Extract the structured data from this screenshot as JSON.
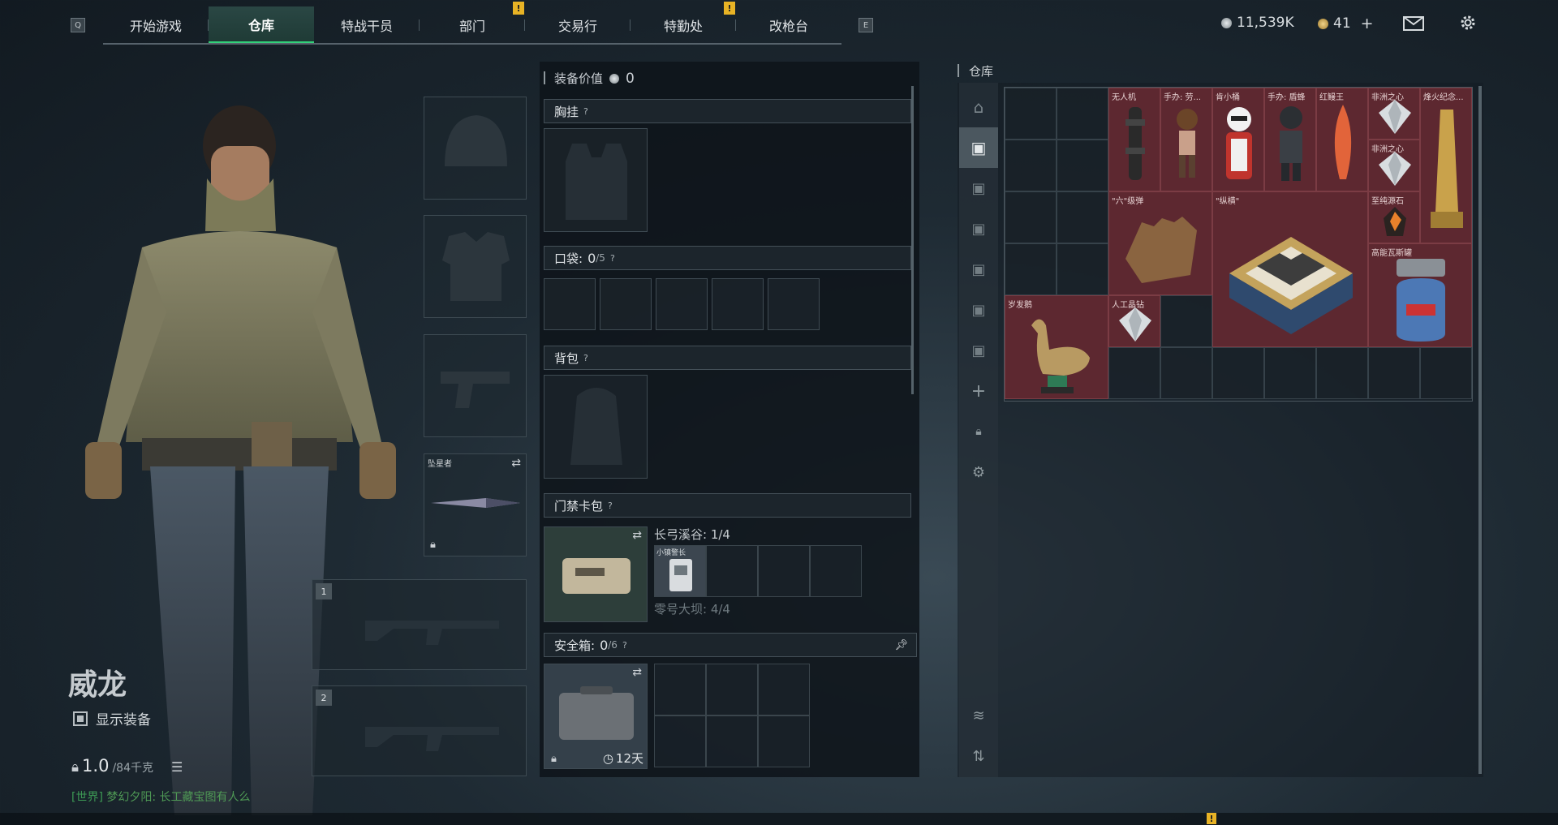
{
  "nav": {
    "key_left": "Q",
    "key_right": "E",
    "tabs": [
      {
        "label": "开始游戏",
        "active": false
      },
      {
        "label": "仓库",
        "active": true
      },
      {
        "label": "特战干员",
        "active": false
      },
      {
        "label": "部门",
        "active": false
      },
      {
        "label": "交易行",
        "active": false
      },
      {
        "label": "特勤处",
        "active": false
      },
      {
        "label": "改枪台",
        "active": false
      }
    ],
    "warning_glyph": "!"
  },
  "topbar": {
    "silver_amount": "11,539K",
    "gold_amount": "41",
    "add_glyph": "+",
    "mail_icon": "mail-icon",
    "settings_icon": "gear-icon"
  },
  "character": {
    "name": "威龙",
    "show_gear_label": "显示装备",
    "weight_value": "1.0",
    "weight_capacity": "/84千克",
    "chat_channel": "[世界]",
    "chat_message": "梦幻夕阳: 长工藏宝图有人么"
  },
  "equipment_slots": {
    "melee_label": "坠星者",
    "weapon_slot_1": "1",
    "weapon_slot_2": "2"
  },
  "loadout": {
    "value_label": "装备价值",
    "value_amount": "0",
    "chest_rig": "胸挂",
    "pockets_label": "口袋:",
    "pockets_count": "0",
    "pockets_capacity": "/5",
    "backpack": "背包",
    "keycard_case": "门禁卡包",
    "keycard_map_1": "长弓溪谷: 1/4",
    "keycard_item": "小镇警长",
    "keycard_map_2": "零号大坝: 4/4",
    "safe_box_label": "安全箱:",
    "safe_box_count": "0",
    "safe_box_capacity": "/6",
    "safe_box_timer": "12天",
    "help_glyph": "?"
  },
  "warehouse": {
    "title": "仓库",
    "items": [
      {
        "label": "无人机"
      },
      {
        "label": "手办: 劳..."
      },
      {
        "label": "肯小桶"
      },
      {
        "label": "手办: 盾蜂"
      },
      {
        "label": "红鳗王"
      },
      {
        "label": "非洲之心"
      },
      {
        "label": "烽火纪念..."
      },
      {
        "label": "非洲之心"
      },
      {
        "label": "\"六\"级弹"
      },
      {
        "label": "\"纵横\""
      },
      {
        "label": "至纯源石"
      },
      {
        "label": "高能瓦斯罐"
      },
      {
        "label": "岁发鹅"
      },
      {
        "label": "人工晶钻"
      }
    ]
  },
  "colors": {
    "accent_green": "#33d17a",
    "item_bg": "#5d2830",
    "warn_yellow": "#e8b325"
  }
}
